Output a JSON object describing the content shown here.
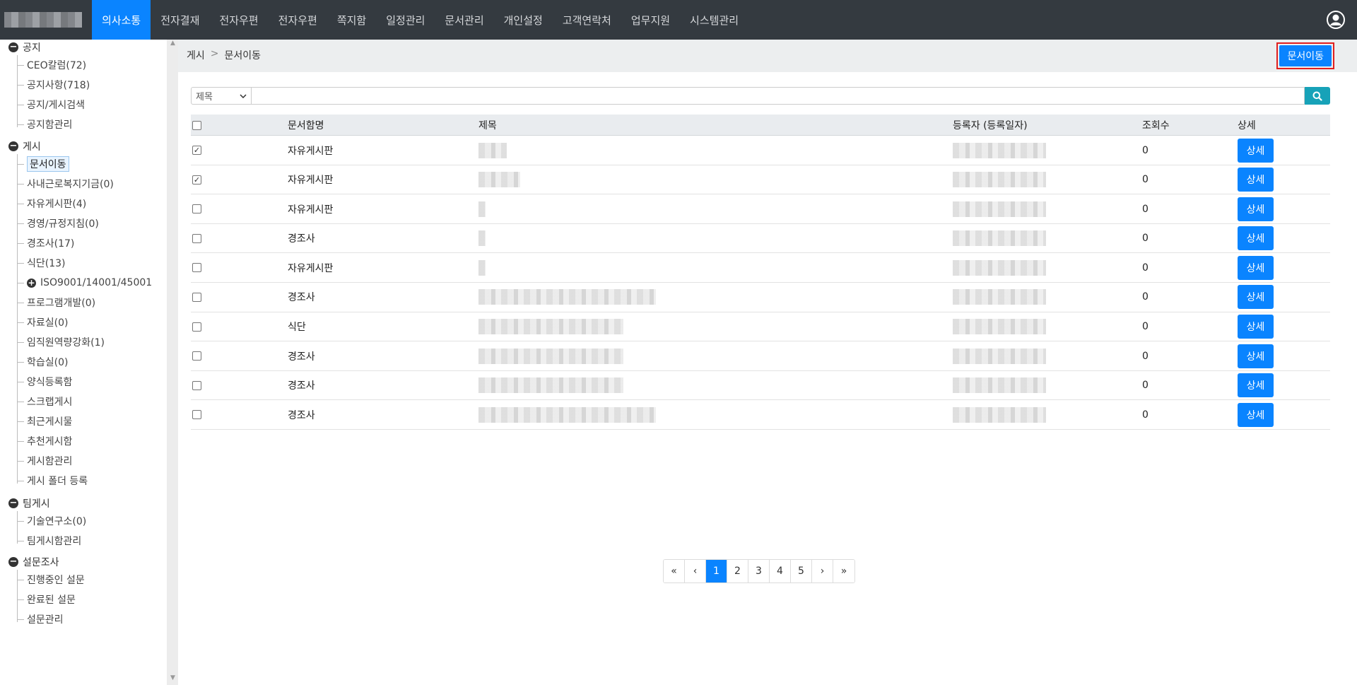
{
  "nav": {
    "menu": [
      "의사소통",
      "전자결재",
      "전자우편",
      "전자우편",
      "쪽지함",
      "일정관리",
      "문서관리",
      "개인설정",
      "고객연락처",
      "업무지원",
      "시스템관리"
    ],
    "active_index": 0,
    "user_icon": "user-circle-icon"
  },
  "sidebar": {
    "cat1": "공지",
    "cat1_items": [
      "CEO칼럼(72)",
      "공지사항(718)",
      "공지/게시검색",
      "공지함관리"
    ],
    "cat2": "게시",
    "cat2_items": [
      "문서이동",
      "사내근로복지기금(0)",
      "자유게시판(4)",
      "경영/규정지침(0)",
      "경조사(17)",
      "식단(13)",
      "ISO9001/14001/45001",
      "프로그램개발(0)",
      "자료실(0)",
      "임직원역량강화(1)",
      "학습실(0)",
      "양식등록함",
      "스크랩게시",
      "최근게시물",
      "추천게시함",
      "게시함관리",
      "게시 폴더 등록"
    ],
    "cat3": "팀게시",
    "cat3_items": [
      "기술연구소(0)",
      "팀게시함관리"
    ],
    "cat4": "설문조사",
    "cat4_items": [
      "진행중인 설문",
      "완료된 설문",
      "설문관리"
    ]
  },
  "breadcrumb": {
    "parent": "게시",
    "separator": ">",
    "current": "문서이동"
  },
  "move_button": "문서이동",
  "search": {
    "select_value": "제목",
    "search_icon": "search-icon"
  },
  "table": {
    "headers": {
      "box": "문서함명",
      "title": "제목",
      "author": "등록자 (등록일자)",
      "views": "조회수",
      "detail": "상세"
    },
    "rows": [
      {
        "checked": true,
        "box": "자유게시판",
        "views": "0",
        "title_w": 0.06,
        "author_w": 0.61
      },
      {
        "checked": true,
        "box": "자유게시판",
        "views": "0",
        "title_w": 0.09,
        "author_w": 0.61
      },
      {
        "checked": false,
        "box": "자유게시판",
        "views": "0",
        "title_w": 0.015,
        "author_w": 0.61
      },
      {
        "checked": false,
        "box": "경조사",
        "views": "0",
        "title_w": 0.015,
        "author_w": 0.61
      },
      {
        "checked": false,
        "box": "자유게시판",
        "views": "0",
        "title_w": 0.015,
        "author_w": 0.61
      },
      {
        "checked": false,
        "box": "경조사",
        "views": "0",
        "title_w": 0.38,
        "author_w": 0.61
      },
      {
        "checked": false,
        "box": "식단",
        "views": "0",
        "title_w": 0.31,
        "author_w": 0.61
      },
      {
        "checked": false,
        "box": "경조사",
        "views": "0",
        "title_w": 0.31,
        "author_w": 0.61
      },
      {
        "checked": false,
        "box": "경조사",
        "views": "0",
        "title_w": 0.31,
        "author_w": 0.61
      },
      {
        "checked": false,
        "box": "경조사",
        "views": "0",
        "title_w": 0.38,
        "author_w": 0.61
      }
    ],
    "detail_label": "상세"
  },
  "pagination": {
    "pages": [
      "1",
      "2",
      "3",
      "4",
      "5"
    ],
    "active": "1",
    "first": "«",
    "prev": "‹",
    "next": "›",
    "last": "»"
  }
}
